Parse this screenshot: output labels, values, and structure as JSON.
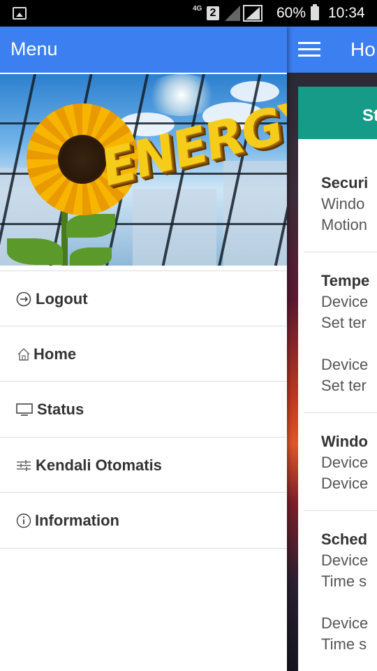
{
  "status_bar": {
    "network": "4G",
    "sim": "2",
    "battery": "60%",
    "time": "10:34"
  },
  "drawer": {
    "title": "Menu",
    "banner_text": "ENERGY",
    "items": [
      {
        "label": "Logout",
        "icon": "logout-icon"
      },
      {
        "label": "Home",
        "icon": "home-icon"
      },
      {
        "label": "Status",
        "icon": "monitor-icon"
      },
      {
        "label": "Kendali Otomatis",
        "icon": "sliders-icon"
      },
      {
        "label": "Information",
        "icon": "info-icon"
      }
    ]
  },
  "main": {
    "title": "Ho",
    "card_header": "St",
    "lines": [
      {
        "text": "Securi",
        "bold": true
      },
      {
        "text": "Windo"
      },
      {
        "text": "Motion"
      },
      {
        "text": "Tempe",
        "bold": true
      },
      {
        "text": "Device"
      },
      {
        "text": "Set ter"
      },
      {
        "text": "Device"
      },
      {
        "text": "Set ter"
      },
      {
        "text": "Windo",
        "bold": true
      },
      {
        "text": "Device"
      },
      {
        "text": "Device"
      },
      {
        "text": "Sched",
        "bold": true
      },
      {
        "text": "Device"
      },
      {
        "text": "Time s"
      },
      {
        "text": "Device"
      },
      {
        "text": "Time s"
      }
    ]
  },
  "colors": {
    "app_bar": "#3b7ff0",
    "card_header": "#159b87"
  }
}
